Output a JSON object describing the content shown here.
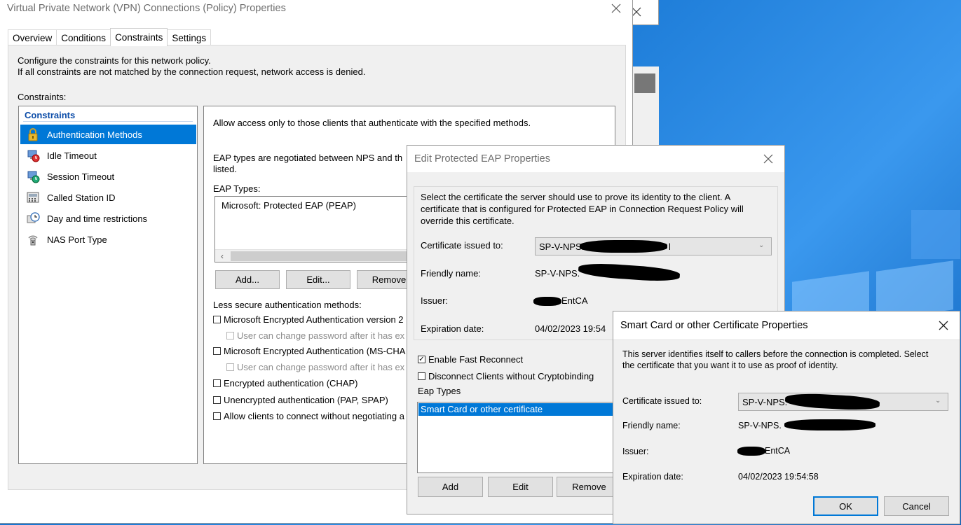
{
  "main_window": {
    "title": "Virtual Private Network (VPN) Connections (Policy) Properties",
    "tabs": [
      "Overview",
      "Conditions",
      "Constraints",
      "Settings"
    ],
    "selected_tab": "Constraints",
    "intro_line1": "Configure the constraints for this network policy.",
    "intro_line2": "If all constraints are not matched by the connection request, network access is denied.",
    "constraints_label": "Constraints:",
    "constraints_header": "Constraints",
    "constraints_items": [
      {
        "label": "Authentication Methods",
        "icon": "lock-icon",
        "selected": true
      },
      {
        "label": "Idle Timeout",
        "icon": "idle-timeout-icon",
        "selected": false
      },
      {
        "label": "Session Timeout",
        "icon": "session-timeout-icon",
        "selected": false
      },
      {
        "label": "Called Station ID",
        "icon": "called-station-icon",
        "selected": false
      },
      {
        "label": "Day and time restrictions",
        "icon": "clock-icon",
        "selected": false
      },
      {
        "label": "NAS Port Type",
        "icon": "nas-port-icon",
        "selected": false
      }
    ],
    "detail": {
      "allow_text": "Allow access only to those clients that authenticate with the specified methods.",
      "eap_negotiated_line1": "EAP types are negotiated between NPS and th",
      "eap_negotiated_line2": "listed.",
      "eap_types_label": "EAP Types:",
      "eap_types_items": [
        "Microsoft: Protected EAP (PEAP)"
      ],
      "add_button": "Add...",
      "edit_button": "Edit...",
      "remove_button": "Remove",
      "less_secure_label": "Less secure authentication methods:",
      "checkboxes": [
        {
          "label": "Microsoft Encrypted Authentication version 2",
          "checked": false,
          "disabled": false,
          "indent": false
        },
        {
          "label": "User can change password after it has ex",
          "checked": false,
          "disabled": true,
          "indent": true
        },
        {
          "label": "Microsoft Encrypted Authentication (MS-CHA",
          "checked": false,
          "disabled": false,
          "indent": false
        },
        {
          "label": "User can change password after it has ex",
          "checked": false,
          "disabled": true,
          "indent": true
        },
        {
          "label": "Encrypted authentication (CHAP)",
          "checked": false,
          "disabled": false,
          "indent": false
        },
        {
          "label": "Unencrypted authentication (PAP, SPAP)",
          "checked": false,
          "disabled": false,
          "indent": false
        },
        {
          "label": "Allow clients to connect without negotiating a",
          "checked": false,
          "disabled": false,
          "indent": false
        }
      ]
    }
  },
  "eap_window": {
    "title": "Edit Protected EAP Properties",
    "description_line1": "Select the certificate the server should use to prove its identity to the client. A",
    "description_line2": "certificate that is configured for Protected EAP in Connection Request Policy will",
    "description_line3": "override this certificate.",
    "cert_issued_label": "Certificate issued to:",
    "cert_issued_value": "SP-V-NPS.",
    "cert_issued_suffix": "l",
    "friendly_label": "Friendly name:",
    "friendly_value": "SP-V-NPS.",
    "issuer_label": "Issuer:",
    "issuer_value": "EntCA",
    "expiration_label": "Expiration date:",
    "expiration_value": "04/02/2023 19:54",
    "enable_fast_reconnect": {
      "label": "Enable Fast Reconnect",
      "checked": true
    },
    "disconnect_clients": {
      "label": "Disconnect Clients without Cryptobinding",
      "checked": false
    },
    "eap_types_label": "Eap Types",
    "eap_types_items": [
      "Smart Card or other certificate"
    ],
    "add_button": "Add",
    "edit_button": "Edit",
    "remove_button": "Remove"
  },
  "smartcard_window": {
    "title": "Smart Card or other Certificate Properties",
    "description_line1": "This server identifies itself to callers before the connection is completed. Select",
    "description_line2": "the certificate that you want it to use as proof of identity.",
    "cert_issued_label": "Certificate issued to:",
    "cert_issued_value": "SP-V-NPS.",
    "friendly_label": "Friendly name:",
    "friendly_value": "SP-V-NPS.",
    "issuer_label": "Issuer:",
    "issuer_value": "EntCA",
    "expiration_label": "Expiration date:",
    "expiration_value": "04/02/2023 19:54:58",
    "ok_button": "OK",
    "cancel_button": "Cancel"
  },
  "colors": {
    "selection": "#0078d7",
    "header_blue": "#0b4ca8",
    "dialog_bg": "#f0f0f0",
    "button_bg": "#e1e1e1"
  }
}
